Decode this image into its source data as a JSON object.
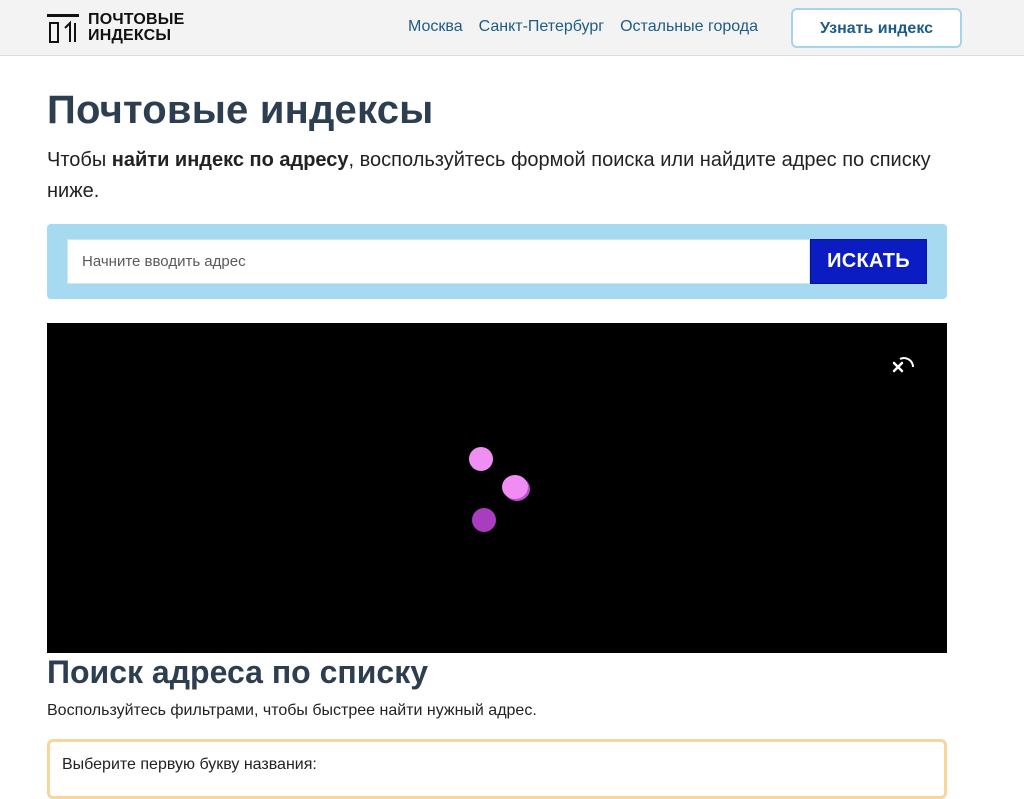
{
  "header": {
    "logo": {
      "line1": "ПОЧТОВЫЕ",
      "line2": "ИНДЕКСЫ"
    },
    "nav": [
      "Москва",
      "Санкт-Петербург",
      "Остальные города"
    ],
    "cta_label": "Узнать индекс"
  },
  "main": {
    "title": "Почтовые индексы",
    "lead_prefix": "Чтобы ",
    "lead_bold": "найти индекс по адресу",
    "lead_suffix": ", воспользуйтесь формой поиска или найдите адрес по списку ниже.",
    "search": {
      "placeholder": "Начните вводить адрес",
      "value": "",
      "button_label": "ИСКАТЬ"
    },
    "ad": {
      "close_icon": "close-icon",
      "loading_icon": "loading-dots-icon",
      "dot_colors": [
        "#ef8ff4",
        "#f08cf4",
        "#a93dc0"
      ]
    },
    "section_title": "Поиск адреса по списку",
    "section_hint": "Воспользуйтесь фильтрами, чтобы быстрее найти нужный адрес.",
    "filter_label": "Выберите первую букву названия:"
  },
  "colors": {
    "accent": "#0a1cc2",
    "link": "#1d5c85",
    "search_bg": "#a5daf0",
    "filter_border": "#f7d59b"
  }
}
